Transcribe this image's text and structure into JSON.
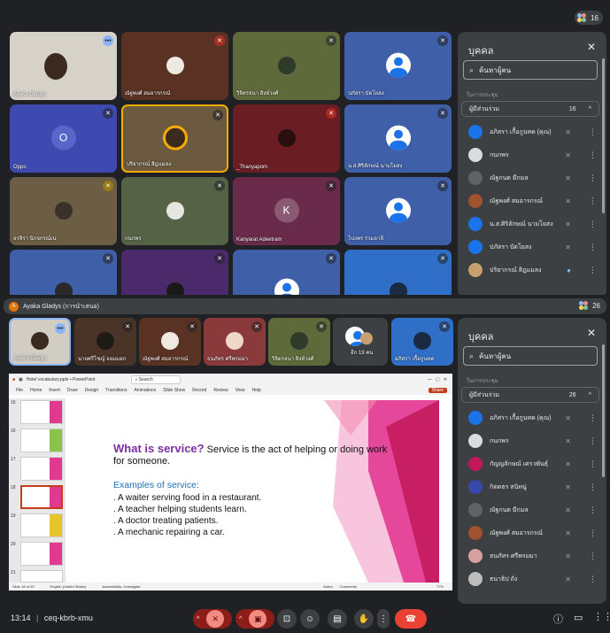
{
  "top_call": {
    "participant_badge": "16",
    "tiles_row1": [
      {
        "name": "Ayaka Gladys",
        "mic": "wave"
      },
      {
        "name": "ณัฐพงศ์ สมอารกรณ์",
        "mic": "off"
      },
      {
        "name": "วิจิตรจนา สิงห์วงศ์",
        "mic": "off"
      },
      {
        "name": "ปภัสรา บัตโยสง",
        "mic": "off"
      }
    ],
    "tiles_row2": [
      {
        "name": "Oppo",
        "mic": "off",
        "initial": "O"
      },
      {
        "name": "ปริยากรณ์ สิฎแมลง",
        "mic": "off"
      },
      {
        "name": "_Thanyaporn",
        "mic": "off"
      },
      {
        "name": "น.ส.ศิริลักษณ์ นามโยสง",
        "mic": "off"
      }
    ],
    "tiles_row3": [
      {
        "name": "อรจิรา นิกจกรณ์เน",
        "mic": "off"
      },
      {
        "name": "กนกพร",
        "mic": "off"
      },
      {
        "name": "Kanyarat Adeetram",
        "mic": "off",
        "initial": "K"
      },
      {
        "name": "โปงพร ร่วมอาลี",
        "mic": "off"
      }
    ],
    "panel": {
      "title": "บุคคล",
      "search_placeholder": "ค้นหาผู้คน",
      "section_label": "ในการประชุม",
      "group_label": "ผู้มีส่วนร่วม",
      "group_count": "16",
      "people": [
        "อภิสรา เกื้อกูนทด (คุณ)",
        "กนกพร",
        "ณัฐกนต มีกมล",
        "ณัฐพงศ์ สมอารกรณ์",
        "น.ส.ศิริลักษณ์ นามโยสง",
        "ปภัสรา บัตโยสง",
        "ปริยากรณ์ สิฎแมลง"
      ]
    }
  },
  "bottom_call": {
    "presenter_bar": "Ayaka Gladys (การนำเสนอ)",
    "participant_badge": "26",
    "filmstrip": [
      {
        "name": "Ayaka Gladys",
        "mic": "wave"
      },
      {
        "name": "นายศรีโชญ์ จอมมอก",
        "mic": "off"
      },
      {
        "name": "ณัฐพงศ์ สมอารกรณ์",
        "mic": "off"
      },
      {
        "name": "ธนภัทร ศรีพรมมา",
        "mic": "off"
      },
      {
        "name": "วิจิตรจนา สิงห์วงศ์",
        "mic": "off"
      },
      {
        "name": "อีก 19 คน",
        "mic": ""
      },
      {
        "name": "อภิสรา เกื้อกูนทด",
        "mic": "off"
      }
    ],
    "ppt": {
      "title_bar": "Hotel vocabulary.pptx • PowerPoint",
      "search": "Search",
      "share": "Share",
      "menu": [
        "File",
        "Home",
        "Insert",
        "Draw",
        "Design",
        "Transitions",
        "Animations",
        "Slide Show",
        "Record",
        "Review",
        "View",
        "Help"
      ],
      "slide_numbers": [
        "15",
        "16",
        "17",
        "18",
        "19",
        "20",
        "21"
      ],
      "slide": {
        "heading": "What is service?",
        "heading_rest": " Service is the act of helping or doing work",
        "heading_line2": "for someone.",
        "subheading": "Examples of service:",
        "items": [
          ". A waiter serving food in a restaurant.",
          ". A teacher helping students learn.",
          ". A doctor treating patients.",
          ". A mechanic repairing a car."
        ]
      },
      "status_left": "Slide 18 of 29",
      "status_lang": "English (United States)",
      "status_access": "Accessibility: Investigate",
      "status_notes": "Notes",
      "status_comments": "Comments",
      "zoom": "77%"
    },
    "panel": {
      "title": "บุคคล",
      "search_placeholder": "ค้นหาผู้คน",
      "section_label": "ในการประชุม",
      "group_label": "ผู้มีส่วนร่วม",
      "group_count": "26",
      "people": [
        "อภิสรา เกื้อกูนทด (คุณ)",
        "กนกพร",
        "กัญญลักษณ์ เศรวพันธุ์",
        "กิตตธร สนิทนู่",
        "ณัฐกนต มีกมล",
        "ณัฐพงศ์ สมอารกรณ์",
        "ธนภัทร ศรีพรมมา",
        "ธนาธิป ถัง"
      ]
    }
  },
  "controls": {
    "time": "13:14",
    "separator": "|",
    "meeting_code": "ceq-kbrb-xmu"
  }
}
